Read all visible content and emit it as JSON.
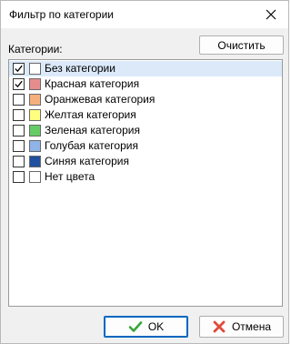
{
  "window": {
    "title": "Фильтр по категории"
  },
  "list_label": "Категории:",
  "clear_label": "Очистить",
  "categories": [
    {
      "label": "Без категории",
      "checked": true,
      "color": "#ffffff",
      "selected": true
    },
    {
      "label": "Красная категория",
      "checked": true,
      "color": "#e78c8c",
      "selected": false
    },
    {
      "label": "Оранжевая категория",
      "checked": false,
      "color": "#f4b07c",
      "selected": false
    },
    {
      "label": "Желтая категория",
      "checked": false,
      "color": "#ffff80",
      "selected": false
    },
    {
      "label": "Зеленая категория",
      "checked": false,
      "color": "#66cc66",
      "selected": false
    },
    {
      "label": "Голубая категория",
      "checked": false,
      "color": "#8fb4e8",
      "selected": false
    },
    {
      "label": "Синяя категория",
      "checked": false,
      "color": "#2050a0",
      "selected": false
    },
    {
      "label": "Нет цвета",
      "checked": false,
      "color": "#ffffff",
      "selected": false
    }
  ],
  "buttons": {
    "ok": "OK",
    "cancel": "Отмена"
  },
  "icons": {
    "close": "close-icon",
    "ok": "check-icon",
    "cancel": "cross-icon"
  }
}
